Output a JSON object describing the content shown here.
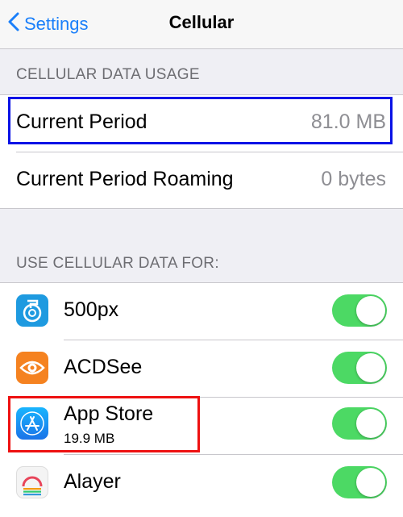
{
  "nav": {
    "back_label": "Settings",
    "title": "Cellular"
  },
  "usage": {
    "header": "CELLULAR DATA USAGE",
    "rows": [
      {
        "label": "Current Period",
        "value": "81.0 MB"
      },
      {
        "label": "Current Period Roaming",
        "value": "0 bytes"
      }
    ]
  },
  "apps": {
    "header": "USE CELLULAR DATA FOR:",
    "items": [
      {
        "name": "500px",
        "sub": "",
        "enabled": true,
        "icon": "500px-app-icon"
      },
      {
        "name": "ACDSee",
        "sub": "",
        "enabled": true,
        "icon": "acdsee-app-icon"
      },
      {
        "name": "App Store",
        "sub": "19.9 MB",
        "enabled": true,
        "icon": "app-store-icon"
      },
      {
        "name": "Alayer",
        "sub": "",
        "enabled": true,
        "icon": "alayer-app-icon"
      }
    ]
  },
  "colors": {
    "accent": "#1a7ffa",
    "toggle_on": "#4cd964",
    "annotation_blue": "#0a12e6",
    "annotation_red": "#ee1111"
  }
}
